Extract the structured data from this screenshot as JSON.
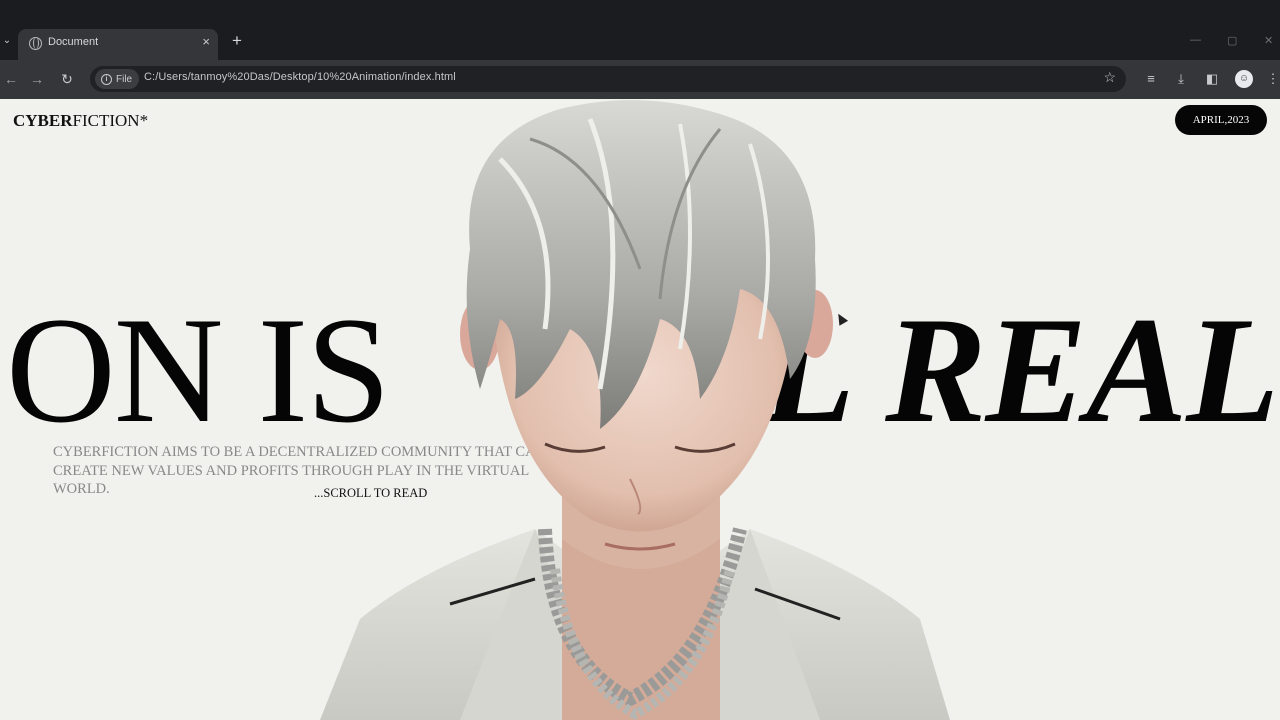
{
  "browser": {
    "tab_title": "Document",
    "close_glyph": "×",
    "new_tab_glyph": "+",
    "chip_label": "File",
    "url": "C:/Users/tanmoy%20Das/Desktop/10%20Animation/index.html",
    "icons": [
      "tab-list-icon",
      "globe-icon",
      "close-icon",
      "plus-icon",
      "back-icon",
      "forward-icon",
      "reload-icon",
      "info-icon",
      "star-icon",
      "reading-list-icon",
      "download-icon",
      "side-panel-icon",
      "profile-icon",
      "menu-icon"
    ]
  },
  "page": {
    "logo_bold": "CYBER",
    "logo_rest": "FICTION*",
    "date_label": "APRIL,2023",
    "hero_left": "ON IS",
    "hero_right": "L REAL",
    "about_text": "CYBERFICTION AIMS TO BE A DECENTRALIZED COMMUNITY THAT CAN CREATE NEW VALUES AND PROFITS THROUGH PLAY IN THE VIRTUAL WORLD.",
    "scroll_label": "...SCROLL TO READ"
  },
  "colors": {
    "page_bg": "#f1f2ee",
    "ink": "#050505",
    "chrome_bg": "#202124",
    "toolbar_bg": "#35363a"
  }
}
